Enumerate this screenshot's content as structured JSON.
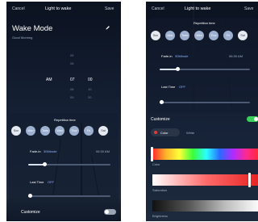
{
  "left": {
    "header": {
      "cancel": "Cancel",
      "title": "Light to wake",
      "save": "Save"
    },
    "mode": {
      "title": "Wake Mode",
      "subtitle": "Good Morning"
    },
    "time_picker": {
      "ampm": [
        "AM"
      ],
      "hours": [
        "05",
        "06",
        "07",
        "08",
        "09"
      ],
      "minutes": [
        "",
        "",
        "00",
        "10",
        "20"
      ],
      "selected": {
        "ampm": "AM",
        "hour": "07",
        "minute": "00"
      }
    },
    "repetition": {
      "label": "Repetition time",
      "days": [
        {
          "label": "Sun",
          "selected": false
        },
        {
          "label": "Mon",
          "selected": true
        },
        {
          "label": "Tues",
          "selected": true
        },
        {
          "label": "Wed",
          "selected": true
        },
        {
          "label": "Thur",
          "selected": true
        },
        {
          "label": "Fri",
          "selected": true
        },
        {
          "label": "Sat",
          "selected": false
        }
      ]
    },
    "fade_in": {
      "label": "Fade-in",
      "value": "30Minute",
      "time": "06:30 AM",
      "level": 0.2
    },
    "last_time": {
      "label": "Last Time",
      "value": "OFF",
      "level": 0.02
    },
    "customize": {
      "label": "Customize",
      "enabled": false
    }
  },
  "right": {
    "header": {
      "cancel": "Cancel",
      "title": "Light to wake",
      "save": "Save"
    },
    "repetition": {
      "label": "Repetition time",
      "days": [
        {
          "label": "Sun",
          "selected": false
        },
        {
          "label": "Mon",
          "selected": true
        },
        {
          "label": "Tues",
          "selected": true
        },
        {
          "label": "Wed",
          "selected": true
        },
        {
          "label": "Thur",
          "selected": true
        },
        {
          "label": "Fri",
          "selected": true
        },
        {
          "label": "Sat",
          "selected": false
        }
      ]
    },
    "fade_in": {
      "label": "Fade-in",
      "value": "30Minute",
      "time": "06:30 AM",
      "level": 0.2
    },
    "last_time": {
      "label": "Last Time",
      "value": "OFF",
      "level": 0.02
    },
    "customize": {
      "label": "Customize",
      "enabled": true
    },
    "color_tabs": [
      {
        "label": "Color",
        "active": true
      },
      {
        "label": "White",
        "active": false
      }
    ],
    "sliders": {
      "color": {
        "label": "Color"
      },
      "saturation": {
        "label": "Saturation"
      },
      "brightness": {
        "label": "Brightness"
      }
    }
  },
  "colors": {
    "accent_toggle_on": "#3ccf5a",
    "toggle_off": "#9aa4b3",
    "day_selected": "#9db0cf",
    "day_unselected": "#e5e9f0",
    "red_swatch": "#e53935"
  },
  "icons": {
    "edit": "pencil-icon"
  }
}
